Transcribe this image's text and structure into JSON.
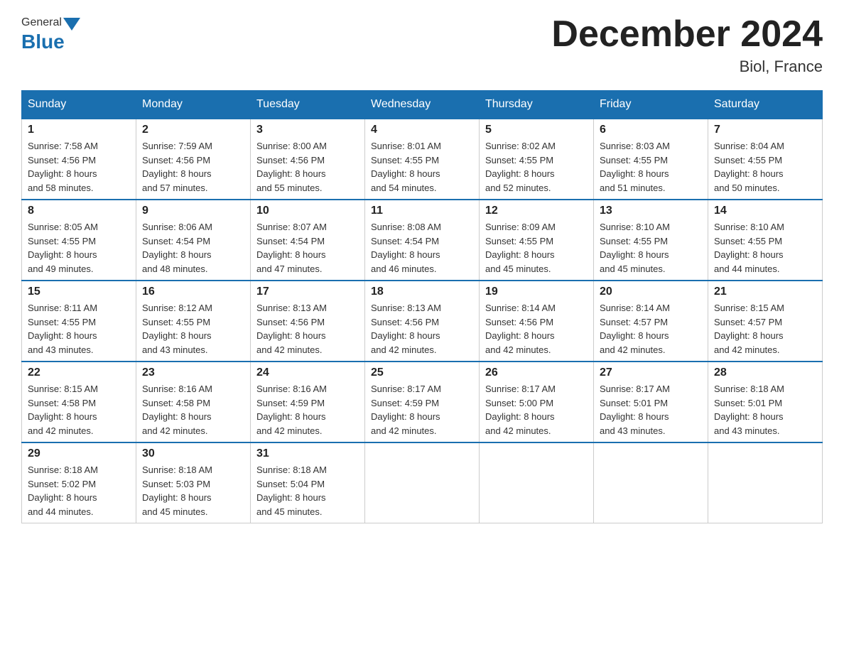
{
  "header": {
    "logo_general": "General",
    "logo_blue": "Blue",
    "month_title": "December 2024",
    "location": "Biol, France"
  },
  "days_of_week": [
    "Sunday",
    "Monday",
    "Tuesday",
    "Wednesday",
    "Thursday",
    "Friday",
    "Saturday"
  ],
  "weeks": [
    [
      {
        "day": "1",
        "sunrise": "Sunrise: 7:58 AM",
        "sunset": "Sunset: 4:56 PM",
        "daylight": "Daylight: 8 hours",
        "minutes": "and 58 minutes."
      },
      {
        "day": "2",
        "sunrise": "Sunrise: 7:59 AM",
        "sunset": "Sunset: 4:56 PM",
        "daylight": "Daylight: 8 hours",
        "minutes": "and 57 minutes."
      },
      {
        "day": "3",
        "sunrise": "Sunrise: 8:00 AM",
        "sunset": "Sunset: 4:56 PM",
        "daylight": "Daylight: 8 hours",
        "minutes": "and 55 minutes."
      },
      {
        "day": "4",
        "sunrise": "Sunrise: 8:01 AM",
        "sunset": "Sunset: 4:55 PM",
        "daylight": "Daylight: 8 hours",
        "minutes": "and 54 minutes."
      },
      {
        "day": "5",
        "sunrise": "Sunrise: 8:02 AM",
        "sunset": "Sunset: 4:55 PM",
        "daylight": "Daylight: 8 hours",
        "minutes": "and 52 minutes."
      },
      {
        "day": "6",
        "sunrise": "Sunrise: 8:03 AM",
        "sunset": "Sunset: 4:55 PM",
        "daylight": "Daylight: 8 hours",
        "minutes": "and 51 minutes."
      },
      {
        "day": "7",
        "sunrise": "Sunrise: 8:04 AM",
        "sunset": "Sunset: 4:55 PM",
        "daylight": "Daylight: 8 hours",
        "minutes": "and 50 minutes."
      }
    ],
    [
      {
        "day": "8",
        "sunrise": "Sunrise: 8:05 AM",
        "sunset": "Sunset: 4:55 PM",
        "daylight": "Daylight: 8 hours",
        "minutes": "and 49 minutes."
      },
      {
        "day": "9",
        "sunrise": "Sunrise: 8:06 AM",
        "sunset": "Sunset: 4:54 PM",
        "daylight": "Daylight: 8 hours",
        "minutes": "and 48 minutes."
      },
      {
        "day": "10",
        "sunrise": "Sunrise: 8:07 AM",
        "sunset": "Sunset: 4:54 PM",
        "daylight": "Daylight: 8 hours",
        "minutes": "and 47 minutes."
      },
      {
        "day": "11",
        "sunrise": "Sunrise: 8:08 AM",
        "sunset": "Sunset: 4:54 PM",
        "daylight": "Daylight: 8 hours",
        "minutes": "and 46 minutes."
      },
      {
        "day": "12",
        "sunrise": "Sunrise: 8:09 AM",
        "sunset": "Sunset: 4:55 PM",
        "daylight": "Daylight: 8 hours",
        "minutes": "and 45 minutes."
      },
      {
        "day": "13",
        "sunrise": "Sunrise: 8:10 AM",
        "sunset": "Sunset: 4:55 PM",
        "daylight": "Daylight: 8 hours",
        "minutes": "and 45 minutes."
      },
      {
        "day": "14",
        "sunrise": "Sunrise: 8:10 AM",
        "sunset": "Sunset: 4:55 PM",
        "daylight": "Daylight: 8 hours",
        "minutes": "and 44 minutes."
      }
    ],
    [
      {
        "day": "15",
        "sunrise": "Sunrise: 8:11 AM",
        "sunset": "Sunset: 4:55 PM",
        "daylight": "Daylight: 8 hours",
        "minutes": "and 43 minutes."
      },
      {
        "day": "16",
        "sunrise": "Sunrise: 8:12 AM",
        "sunset": "Sunset: 4:55 PM",
        "daylight": "Daylight: 8 hours",
        "minutes": "and 43 minutes."
      },
      {
        "day": "17",
        "sunrise": "Sunrise: 8:13 AM",
        "sunset": "Sunset: 4:56 PM",
        "daylight": "Daylight: 8 hours",
        "minutes": "and 42 minutes."
      },
      {
        "day": "18",
        "sunrise": "Sunrise: 8:13 AM",
        "sunset": "Sunset: 4:56 PM",
        "daylight": "Daylight: 8 hours",
        "minutes": "and 42 minutes."
      },
      {
        "day": "19",
        "sunrise": "Sunrise: 8:14 AM",
        "sunset": "Sunset: 4:56 PM",
        "daylight": "Daylight: 8 hours",
        "minutes": "and 42 minutes."
      },
      {
        "day": "20",
        "sunrise": "Sunrise: 8:14 AM",
        "sunset": "Sunset: 4:57 PM",
        "daylight": "Daylight: 8 hours",
        "minutes": "and 42 minutes."
      },
      {
        "day": "21",
        "sunrise": "Sunrise: 8:15 AM",
        "sunset": "Sunset: 4:57 PM",
        "daylight": "Daylight: 8 hours",
        "minutes": "and 42 minutes."
      }
    ],
    [
      {
        "day": "22",
        "sunrise": "Sunrise: 8:15 AM",
        "sunset": "Sunset: 4:58 PM",
        "daylight": "Daylight: 8 hours",
        "minutes": "and 42 minutes."
      },
      {
        "day": "23",
        "sunrise": "Sunrise: 8:16 AM",
        "sunset": "Sunset: 4:58 PM",
        "daylight": "Daylight: 8 hours",
        "minutes": "and 42 minutes."
      },
      {
        "day": "24",
        "sunrise": "Sunrise: 8:16 AM",
        "sunset": "Sunset: 4:59 PM",
        "daylight": "Daylight: 8 hours",
        "minutes": "and 42 minutes."
      },
      {
        "day": "25",
        "sunrise": "Sunrise: 8:17 AM",
        "sunset": "Sunset: 4:59 PM",
        "daylight": "Daylight: 8 hours",
        "minutes": "and 42 minutes."
      },
      {
        "day": "26",
        "sunrise": "Sunrise: 8:17 AM",
        "sunset": "Sunset: 5:00 PM",
        "daylight": "Daylight: 8 hours",
        "minutes": "and 42 minutes."
      },
      {
        "day": "27",
        "sunrise": "Sunrise: 8:17 AM",
        "sunset": "Sunset: 5:01 PM",
        "daylight": "Daylight: 8 hours",
        "minutes": "and 43 minutes."
      },
      {
        "day": "28",
        "sunrise": "Sunrise: 8:18 AM",
        "sunset": "Sunset: 5:01 PM",
        "daylight": "Daylight: 8 hours",
        "minutes": "and 43 minutes."
      }
    ],
    [
      {
        "day": "29",
        "sunrise": "Sunrise: 8:18 AM",
        "sunset": "Sunset: 5:02 PM",
        "daylight": "Daylight: 8 hours",
        "minutes": "and 44 minutes."
      },
      {
        "day": "30",
        "sunrise": "Sunrise: 8:18 AM",
        "sunset": "Sunset: 5:03 PM",
        "daylight": "Daylight: 8 hours",
        "minutes": "and 45 minutes."
      },
      {
        "day": "31",
        "sunrise": "Sunrise: 8:18 AM",
        "sunset": "Sunset: 5:04 PM",
        "daylight": "Daylight: 8 hours",
        "minutes": "and 45 minutes."
      },
      null,
      null,
      null,
      null
    ]
  ]
}
